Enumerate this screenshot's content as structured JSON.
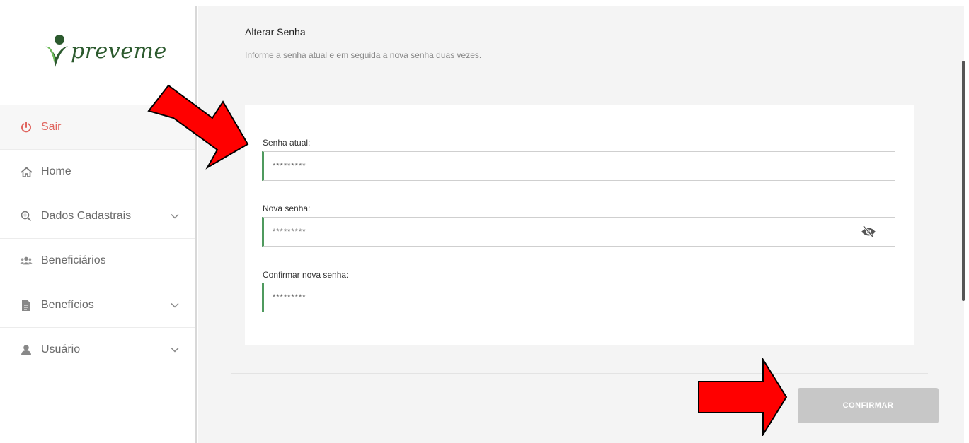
{
  "brand": {
    "name": "preveme",
    "color": "#2c5a2e"
  },
  "sidebar": {
    "items": [
      {
        "label": "Sair",
        "icon": "power-icon",
        "has_chevron": false
      },
      {
        "label": "Home",
        "icon": "home-icon",
        "has_chevron": false
      },
      {
        "label": "Dados Cadastrais",
        "icon": "search-plus-icon",
        "has_chevron": true
      },
      {
        "label": "Beneficiários",
        "icon": "users-icon",
        "has_chevron": false
      },
      {
        "label": "Benefícios",
        "icon": "document-icon",
        "has_chevron": true
      },
      {
        "label": "Usuário",
        "icon": "user-icon",
        "has_chevron": true
      }
    ]
  },
  "main": {
    "title": "Alterar Senha",
    "subtitle": "Informe a senha atual e em seguida a nova senha duas vezes.",
    "fields": {
      "current": {
        "label": "Senha atual:",
        "value": "*********"
      },
      "new": {
        "label": "Nova senha:",
        "value": "*********",
        "toggle_icon": "eye-slash-icon"
      },
      "confirm": {
        "label": "Confirmar nova senha:",
        "value": "*********"
      }
    },
    "confirm_label": "CONFIRMAR"
  },
  "colors": {
    "accent_green": "#4f9a5e",
    "logout_red": "#e0645e",
    "arrow_red": "#ff0000",
    "button_gray": "#c7c7c7"
  }
}
